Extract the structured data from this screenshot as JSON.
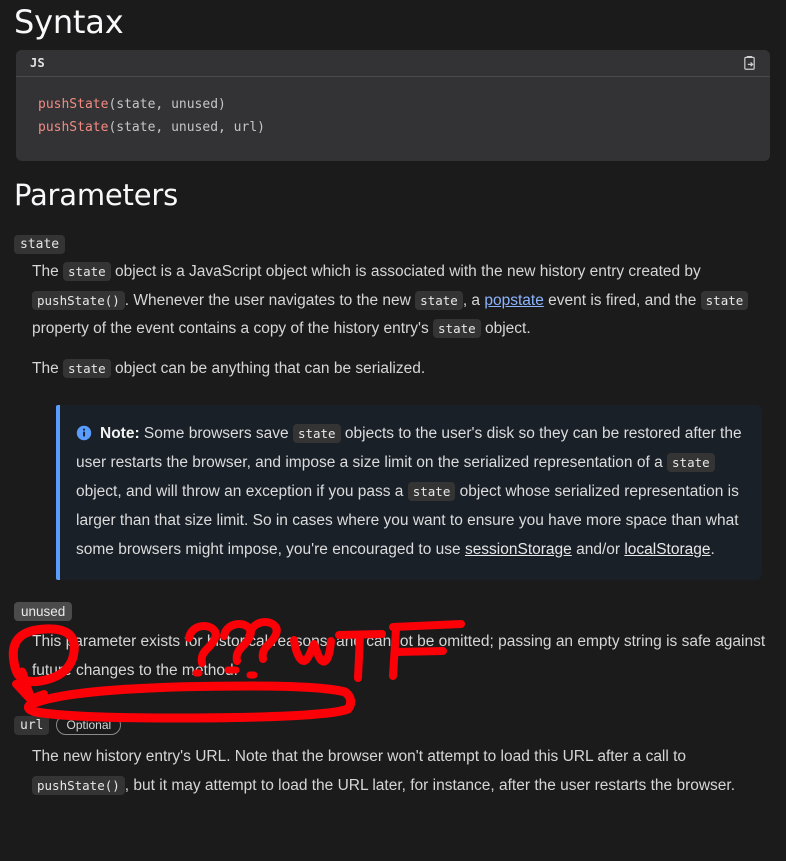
{
  "page": {
    "background": "#1b1b1b",
    "text_color": "#d6d6d6"
  },
  "syntax": {
    "heading": "Syntax",
    "code_block": {
      "language_label": "JS",
      "copy_icon": "clipboard-copy-icon",
      "lines": [
        {
          "fn": "pushState",
          "args": "(state, unused)"
        },
        {
          "fn": "pushState",
          "args": "(state, unused, url)"
        }
      ],
      "raw": "pushState(state, unused)\npushState(state, unused, url)",
      "function_color": "#f28b82",
      "background": "#333336"
    }
  },
  "parameters": {
    "heading": "Parameters",
    "items": [
      {
        "name": "state",
        "optional_badge": null,
        "paragraphs": [
          {
            "parts": [
              {
                "t": "text",
                "v": "The "
              },
              {
                "t": "code",
                "v": "state"
              },
              {
                "t": "text",
                "v": " object is a JavaScript object which is associated with the new history entry created by "
              },
              {
                "t": "code",
                "v": "pushState()"
              },
              {
                "t": "text",
                "v": ". Whenever the user navigates to the new "
              },
              {
                "t": "code",
                "v": "state"
              },
              {
                "t": "text",
                "v": ", a "
              },
              {
                "t": "codelink",
                "v": "popstate"
              },
              {
                "t": "text",
                "v": " event is fired, and the "
              },
              {
                "t": "code",
                "v": "state"
              },
              {
                "t": "text",
                "v": " property of the event contains a copy of the history entry's "
              },
              {
                "t": "code",
                "v": "state"
              },
              {
                "t": "text",
                "v": " object."
              }
            ]
          },
          {
            "parts": [
              {
                "t": "text",
                "v": "The "
              },
              {
                "t": "code",
                "v": "state"
              },
              {
                "t": "text",
                "v": " object can be anything that can be serialized."
              }
            ]
          }
        ],
        "note": {
          "icon": "info-icon",
          "label": "Note:",
          "accent_color": "#5b9dff",
          "background": "#192028",
          "parts": [
            {
              "t": "text",
              "v": " Some browsers save "
            },
            {
              "t": "code",
              "v": "state"
            },
            {
              "t": "text",
              "v": " objects to the user's disk so they can be restored after the user restarts the browser, and impose a size limit on the serialized representation of a "
            },
            {
              "t": "code",
              "v": "state"
            },
            {
              "t": "text",
              "v": " object, and will throw an exception if you pass a "
            },
            {
              "t": "code",
              "v": "state"
            },
            {
              "t": "text",
              "v": " object whose serialized representation is larger than that size limit. So in cases where you want to ensure you have more space than what some browsers might impose, you're encouraged to use "
            },
            {
              "t": "codelink-plain",
              "v": "sessionStorage"
            },
            {
              "t": "text",
              "v": " and/or "
            },
            {
              "t": "codelink-plain",
              "v": "localStorage"
            },
            {
              "t": "text",
              "v": "."
            }
          ]
        }
      },
      {
        "name": "unused",
        "optional_badge": null,
        "paragraphs": [
          {
            "parts": [
              {
                "t": "text",
                "v": "This parameter exists for historical reasons, and cannot be omitted; passing an empty string is safe against future changes to the method."
              }
            ]
          }
        ]
      },
      {
        "name": "url",
        "optional_badge": "Optional",
        "paragraphs": [
          {
            "parts": [
              {
                "t": "text",
                "v": "The new history entry's URL. Note that the browser won't attempt to load this URL after a call to "
              },
              {
                "t": "code",
                "v": "pushState()"
              },
              {
                "t": "text",
                "v": ", but it may attempt to load the URL later, for instance, after the user restarts the browser."
              }
            ]
          }
        ]
      }
    ]
  },
  "annotations": {
    "color": "#fb0007",
    "marks": [
      {
        "name": "question-marks-scribble",
        "text": "???"
      },
      {
        "name": "wtf-scribble",
        "text": "wTF"
      },
      {
        "name": "circle-around-unused-term",
        "text": ""
      },
      {
        "name": "arrow-to-paragraph",
        "text": ""
      },
      {
        "name": "box-around-historical-reasons-text",
        "text": ""
      }
    ]
  }
}
